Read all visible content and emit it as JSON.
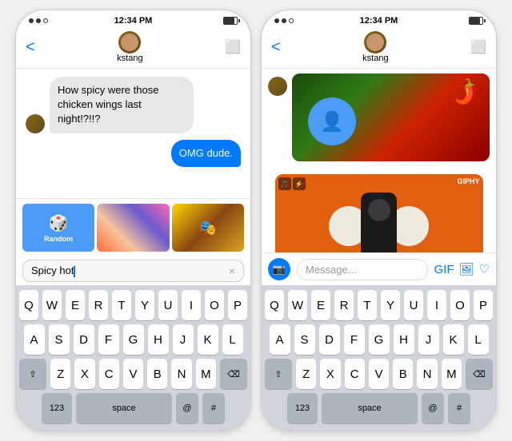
{
  "phones": {
    "left": {
      "statusBar": {
        "dots": [
          "filled",
          "filled",
          "empty"
        ],
        "time": "12:34 PM",
        "battery": true
      },
      "header": {
        "backLabel": "<",
        "username": "kstang",
        "videoIcon": "⬜"
      },
      "messages": [
        {
          "type": "incoming",
          "text": "How spicy were those chicken wings last night!?!!?"
        },
        {
          "type": "outgoing",
          "text": "OMG dude."
        }
      ],
      "gifGrid": {
        "randomLabel": "Random",
        "items": [
          "random",
          "preview1",
          "preview2"
        ]
      },
      "searchBar": {
        "text": "Spicy hot",
        "clearIcon": "×"
      },
      "keyboard": {
        "rows": [
          [
            "Q",
            "W",
            "E",
            "R",
            "T",
            "Y",
            "U",
            "I",
            "O",
            "P"
          ],
          [
            "A",
            "S",
            "D",
            "F",
            "G",
            "H",
            "J",
            "K",
            "L"
          ],
          [
            "⇧",
            "Z",
            "X",
            "C",
            "V",
            "B",
            "N",
            "M",
            "⌫"
          ],
          [
            "123",
            "space",
            "@",
            "#"
          ]
        ]
      }
    },
    "right": {
      "statusBar": {
        "dots": [
          "filled",
          "filled",
          "empty"
        ],
        "time": "12:34 PM",
        "battery": true
      },
      "header": {
        "backLabel": "<",
        "username": "kstang",
        "videoIcon": "⬜"
      },
      "gifResults": {
        "topImage": "chili peppers background",
        "bottomImage": "person with pom poms on orange background",
        "giphyBadge": "GIPHY"
      },
      "inputBar": {
        "placeholder": "Message...",
        "gifLabel": "GIF",
        "cameraIcon": "📷"
      },
      "keyboard": {
        "rows": [
          [
            "Q",
            "W",
            "E",
            "R",
            "T",
            "Y",
            "U",
            "I",
            "O",
            "P"
          ],
          [
            "A",
            "S",
            "D",
            "F",
            "G",
            "H",
            "J",
            "K",
            "L"
          ],
          [
            "⇧",
            "Z",
            "X",
            "C",
            "V",
            "B",
            "N",
            "M",
            "⌫"
          ],
          [
            "123",
            "space",
            "@",
            "#"
          ]
        ]
      }
    }
  }
}
